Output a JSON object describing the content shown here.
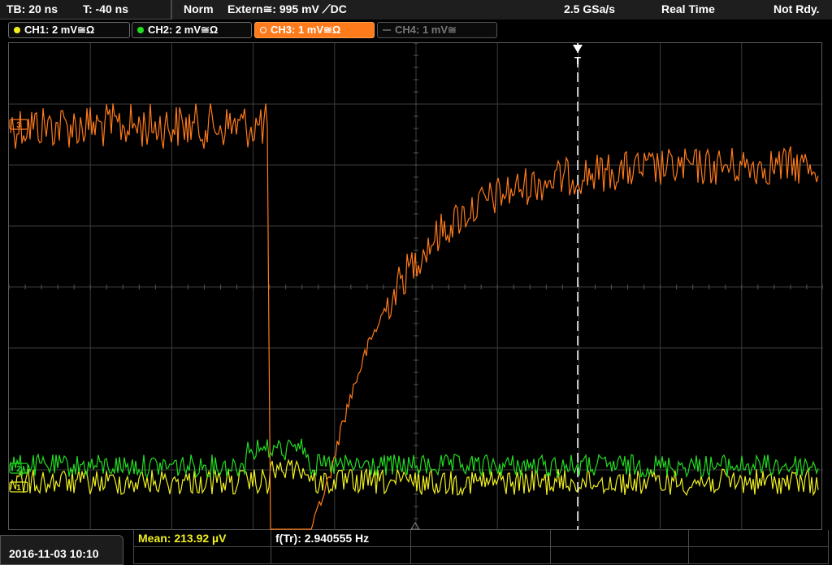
{
  "topbar": {
    "timebase": "TB: 20 ns",
    "trigger_time": "T: -40 ns",
    "trigger_mode": "Norm",
    "trigger_source": "Extern≅: 995 mV ⟋DC",
    "sample_rate": "2.5 GSa/s",
    "acq_mode": "Real Time",
    "status": "Not Rdy."
  },
  "channels": [
    {
      "label": "CH1: 2 mV≅Ω",
      "color": "#f0f020",
      "active": false
    },
    {
      "label": "CH2: 2 mV≅Ω",
      "color": "#22dd22",
      "active": false
    },
    {
      "label": "CH3: 1 mV≅Ω",
      "color": "#ff7a1a",
      "active": true
    },
    {
      "label": "CH4: 1 mV≅",
      "color": "#555555",
      "active": false
    }
  ],
  "markers": {
    "ch3": "3",
    "ch2": "2",
    "ch1": "1",
    "trigger": "T"
  },
  "measurements": {
    "mean": "Mean: 213.92 µV",
    "freq": "f(Tr): 2.940555 Hz"
  },
  "datetime": "2016-11-03 10:10",
  "colors": {
    "ch1": "#f0f020",
    "ch2": "#22dd22",
    "ch3": "#ff7a1a",
    "grid": "#3c3c3c",
    "trigger": "#ffffff"
  }
}
